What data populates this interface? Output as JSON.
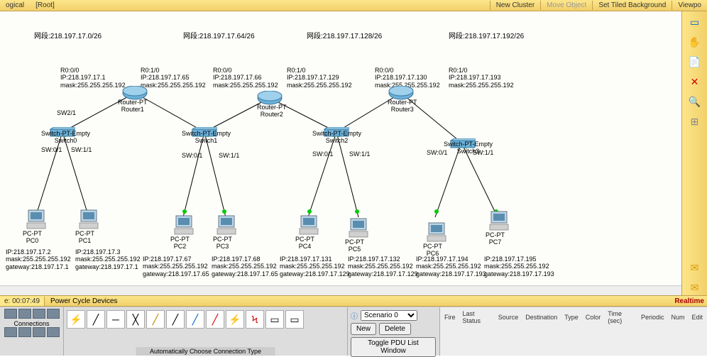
{
  "topbar": {
    "logical": "ogical",
    "root": "[Root]",
    "newcluster": "New Cluster",
    "moveobj": "Move Object",
    "settiled": "Set Tiled Background",
    "viewport": "Viewpo"
  },
  "networks": {
    "n1": "网段:218.197.17.0/26",
    "n2": "网段:218.197.17.64/26",
    "n3": "网段:218.197.17.128/26",
    "n4": "网段:218.197.17.192/26"
  },
  "routers": {
    "r1": {
      "name": "Router-PT\nRouter1",
      "i00": "R0:0/0\nIP:218.197.17.1\nmask:255.255.255.192",
      "i10": "R0:1/0\nIP:218.197.17.65\nmask:255.255.255.192"
    },
    "r2": {
      "name": "Router-PT\nRouter2",
      "i00": "R0:0/0\nIP:218.197.17.66\nmask:255.255.255.192",
      "i10": "R0:1/0\nIP:218.197.17.129\nmask:255.255.255.192"
    },
    "r3": {
      "name": "Router-PT\nRouter3",
      "i00": "R0:0/0\nIP:218.197.17.130\nmask:255.255.255.192",
      "i10": "R0:1/0\nIP:218.197.17.193\nmask:255.255.255.192"
    }
  },
  "switches": {
    "s0": {
      "name": "Switch-PT-Empty\nSwitch0",
      "uplink": "SW2/1",
      "p0": "SW:0/1",
      "p1": "SW:1/1"
    },
    "s1": {
      "name": "Switch-PT-Empty\nSwitch1",
      "p0": "SW:0/1",
      "p1": "SW:1/1"
    },
    "s2": {
      "name": "Switch-PT-Empty\nSwitch2",
      "p0": "SW:0/1",
      "p1": "SW:1/1"
    },
    "s3": {
      "name": "Switch-PT-Empty\nSwitch3",
      "p0": "SW:0/1",
      "p1": "SW:1/1"
    }
  },
  "pcs": {
    "pc0": {
      "name": "PC-PT\nPC0",
      "info": "IP:218.197.17.2\nmask:255.255.255.192\ngateway:218.197.17.1"
    },
    "pc1": {
      "name": "PC-PT\nPC1",
      "info": "IP:218.197.17.3\nmask:255.255.255.192\ngateway:218.197.17.1"
    },
    "pc2": {
      "name": "PC-PT\nPC2",
      "info": "IP:218.197.17.67\nmask:255.255.255.192\ngateway:218.197.17.65"
    },
    "pc3": {
      "name": "PC-PT\nPC3",
      "info": "IP:218.197.17.68\nmask:255.255.255.192\ngateway:218.197.17.65"
    },
    "pc4": {
      "name": "PC-PT\nPC4",
      "info": "IP:218.197.17.131\nmask:255.255.255.192\ngateway:218.197.17.129"
    },
    "pc5": {
      "name": "PC-PT\nPC5",
      "info": "IP:218.197.17.132\nmask:255.255.255.192\ngateway:218.197.17.129"
    },
    "pc6": {
      "name": "PC-PT\nPC6",
      "info": "IP:218.197.17.194\nmask:255.255.255.192\ngateway:218.197.17.193"
    },
    "pc7": {
      "name": "PC-PT\nPC7",
      "info": "IP:218.197.17.195\nmask:255.255.255.192\ngateway:218.197.17.193"
    }
  },
  "statusbar": {
    "time": "e: 00:07:49",
    "powercycle": "Power Cycle Devices",
    "realtime": "Realtime"
  },
  "devpanel": {
    "label": "Connections"
  },
  "connpanel": {
    "auto": "Automatically Choose Connection Type"
  },
  "scenario": {
    "label": "Scenario 0",
    "new": "New",
    "delete": "Delete",
    "toggle": "Toggle PDU List Window"
  },
  "pdu": {
    "cols": [
      "Fire",
      "Last Status",
      "Source",
      "Destination",
      "Type",
      "Color",
      "Time (sec)",
      "Periodic",
      "Num",
      "Edit"
    ]
  }
}
